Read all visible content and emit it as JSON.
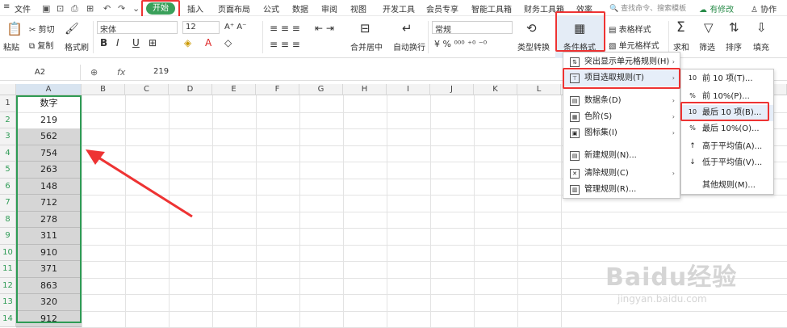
{
  "menubar": {
    "items": [
      "文件",
      "开始",
      "插入",
      "页面布局",
      "公式",
      "数据",
      "审阅",
      "视图",
      "开发工具",
      "会员专享",
      "智能工具箱",
      "财务工具箱",
      "效率"
    ],
    "search_placeholder": "查找命令、搜索模板",
    "right": [
      "有修改",
      "协作"
    ]
  },
  "toolbar": {
    "paste": "粘贴",
    "cut": "剪切",
    "copy": "复制",
    "format_painter": "格式刷",
    "font_name": "宋体",
    "font_size": "12",
    "merge_center": "合并居中",
    "wrap": "自动换行",
    "number_format": "常规",
    "type_convert": "类型转换",
    "conditional_format": "条件格式",
    "table_style": "表格样式",
    "cell_style": "单元格样式",
    "sum": "求和",
    "filter": "筛选",
    "sort": "排序",
    "fill": "填充"
  },
  "formula": {
    "name_box": "A2",
    "fx": "fx",
    "value": "219"
  },
  "columns": [
    "A",
    "B",
    "C",
    "D",
    "E",
    "F",
    "G",
    "H",
    "I",
    "J",
    "K",
    "L"
  ],
  "rows": [
    {
      "num": "1",
      "a": "数字"
    },
    {
      "num": "2",
      "a": "219"
    },
    {
      "num": "3",
      "a": "562"
    },
    {
      "num": "4",
      "a": "754"
    },
    {
      "num": "5",
      "a": "263"
    },
    {
      "num": "6",
      "a": "148"
    },
    {
      "num": "7",
      "a": "712"
    },
    {
      "num": "8",
      "a": "278"
    },
    {
      "num": "9",
      "a": "311"
    },
    {
      "num": "10",
      "a": "910"
    },
    {
      "num": "11",
      "a": "371"
    },
    {
      "num": "12",
      "a": "863"
    },
    {
      "num": "13",
      "a": "320"
    },
    {
      "num": "14",
      "a": "912"
    }
  ],
  "cf_menu": {
    "items": [
      "突出显示单元格规则(H)",
      "项目选取规则(T)",
      "数据条(D)",
      "色阶(S)",
      "图标集(I)",
      "新建规则(N)...",
      "清除规则(C)",
      "管理规则(R)..."
    ]
  },
  "sub_menu": {
    "items": [
      "前 10 项(T)...",
      "前 10%(P)...",
      "最后 10 项(B)...",
      "最后 10%(O)...",
      "高于平均值(A)...",
      "低于平均值(V)...",
      "其他规则(M)..."
    ]
  },
  "watermark": {
    "text": "Baidu经验",
    "url": "jingyan.baidu.com"
  },
  "colors": {
    "accent": "#3aa05a",
    "highlight": "#e33333",
    "selection": "#d6d6d6"
  }
}
